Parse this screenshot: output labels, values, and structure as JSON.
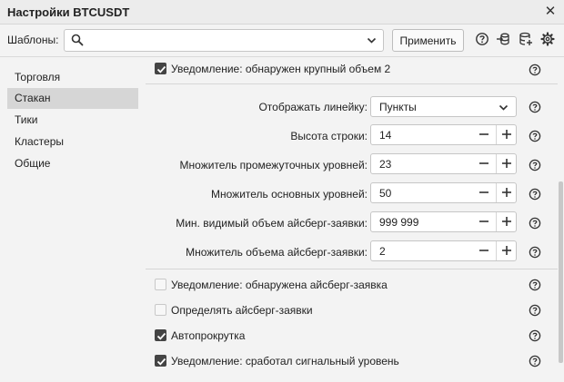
{
  "window": {
    "title": "Настройки BTCUSDT"
  },
  "templates": {
    "label": "Шаблоны:",
    "value": "",
    "apply_label": "Применить"
  },
  "sidebar": {
    "items": [
      {
        "label": "Торговля",
        "active": false
      },
      {
        "label": "Стакан",
        "active": true
      },
      {
        "label": "Тики",
        "active": false
      },
      {
        "label": "Кластеры",
        "active": false
      },
      {
        "label": "Общие",
        "active": false
      }
    ]
  },
  "settings": {
    "top_checkbox": {
      "label": "Уведомление: обнаружен крупный объем 2",
      "checked": true
    },
    "ruler": {
      "label": "Отображать линейку:",
      "value": "Пункты"
    },
    "steppers": [
      {
        "label": "Высота строки:",
        "value": "14"
      },
      {
        "label": "Множитель промежуточных уровней:",
        "value": "23"
      },
      {
        "label": "Множитель основных уровней:",
        "value": "50"
      },
      {
        "label": "Мин. видимый объем айсберг-заявки:",
        "value": "999 999"
      },
      {
        "label": "Множитель объема айсберг-заявки:",
        "value": "2"
      }
    ],
    "checkboxes": [
      {
        "label": "Уведомление: обнаружена айсберг-заявка",
        "checked": false
      },
      {
        "label": "Определять айсберг-заявки",
        "checked": false
      },
      {
        "label": "Автопрокрутка",
        "checked": true
      },
      {
        "label": "Уведомление: сработал сигнальный уровень",
        "checked": true
      }
    ]
  },
  "icons": {
    "close": "close-icon",
    "search": "search-icon",
    "help": "help-icon",
    "import": "import-icon",
    "database": "database-icon",
    "settings": "gear-icon"
  }
}
